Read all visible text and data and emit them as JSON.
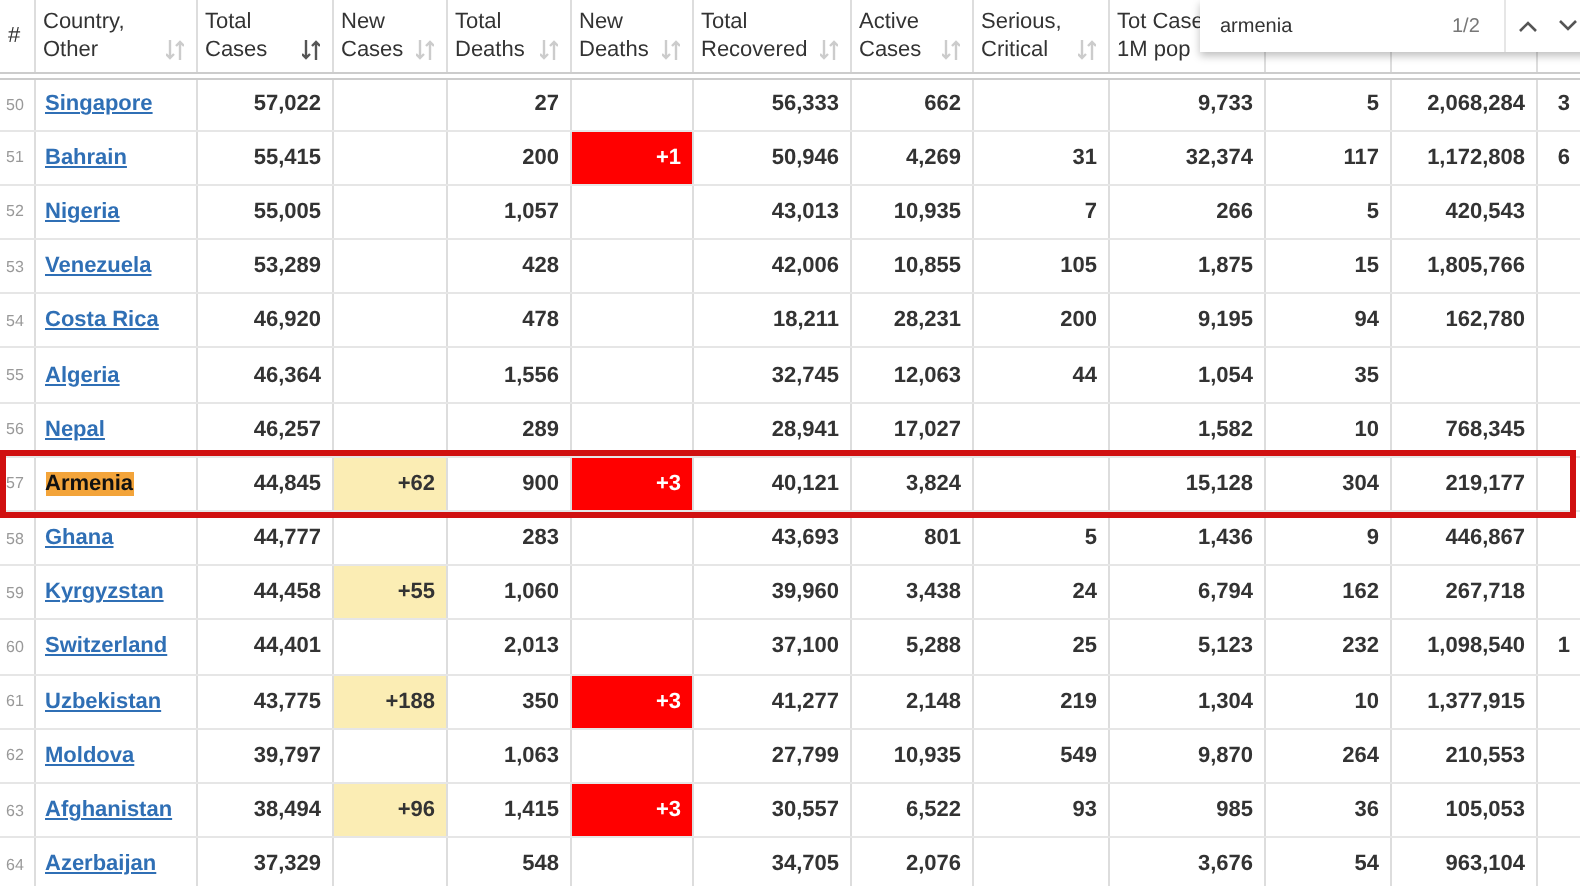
{
  "columns": [
    {
      "lines": [
        "#"
      ],
      "sortable": false
    },
    {
      "lines": [
        "Country,",
        "Other"
      ],
      "sortable": true,
      "sorted": false
    },
    {
      "lines": [
        "Total",
        "Cases"
      ],
      "sortable": true,
      "sorted": true
    },
    {
      "lines": [
        "New",
        "Cases"
      ],
      "sortable": true,
      "sorted": false
    },
    {
      "lines": [
        "Total",
        "Deaths"
      ],
      "sortable": true,
      "sorted": false
    },
    {
      "lines": [
        "New",
        "Deaths"
      ],
      "sortable": true,
      "sorted": false
    },
    {
      "lines": [
        "Total",
        "Recovered"
      ],
      "sortable": true,
      "sorted": false
    },
    {
      "lines": [
        "Active",
        "Cases"
      ],
      "sortable": true,
      "sorted": false
    },
    {
      "lines": [
        "Serious,",
        "Critical"
      ],
      "sortable": true,
      "sorted": false
    },
    {
      "lines": [
        "Tot Case",
        "1M pop"
      ],
      "sortable": false
    }
  ],
  "rows": [
    {
      "rank": "50",
      "country": "Singapore",
      "total_cases": "57,022",
      "total_deaths": "27",
      "total_recovered": "56,333",
      "active_cases": "662",
      "column_10": "9,733",
      "column_11": "5",
      "column_12": "2,068,284",
      "column_13": "3",
      "current_match": false
    },
    {
      "rank": "51",
      "country": "Bahrain",
      "total_cases": "55,415",
      "total_deaths": "200",
      "new_deaths": "+1",
      "total_recovered": "50,946",
      "active_cases": "4,269",
      "serious_critical": "31",
      "column_10": "32,374",
      "column_11": "117",
      "column_12": "1,172,808",
      "column_13": "6",
      "current_match": false
    },
    {
      "rank": "52",
      "country": "Nigeria",
      "total_cases": "55,005",
      "total_deaths": "1,057",
      "total_recovered": "43,013",
      "active_cases": "10,935",
      "serious_critical": "7",
      "column_10": "266",
      "column_11": "5",
      "column_12": "420,543",
      "current_match": false
    },
    {
      "rank": "53",
      "country": "Venezuela",
      "total_cases": "53,289",
      "total_deaths": "428",
      "total_recovered": "42,006",
      "active_cases": "10,855",
      "serious_critical": "105",
      "column_10": "1,875",
      "column_11": "15",
      "column_12": "1,805,766",
      "current_match": false
    },
    {
      "rank": "54",
      "country": "Costa Rica",
      "total_cases": "46,920",
      "total_deaths": "478",
      "total_recovered": "18,211",
      "active_cases": "28,231",
      "serious_critical": "200",
      "column_10": "9,195",
      "column_11": "94",
      "column_12": "162,780",
      "current_match": false
    },
    {
      "rank": "55",
      "country": "Algeria",
      "total_cases": "46,364",
      "total_deaths": "1,556",
      "total_recovered": "32,745",
      "active_cases": "12,063",
      "serious_critical": "44",
      "column_10": "1,054",
      "column_11": "35",
      "current_match": false
    },
    {
      "rank": "56",
      "country": "Nepal",
      "total_cases": "46,257",
      "total_deaths": "289",
      "total_recovered": "28,941",
      "active_cases": "17,027",
      "column_10": "1,582",
      "column_11": "10",
      "column_12": "768,345",
      "current_match": false
    },
    {
      "rank": "57",
      "country": "Armenia",
      "total_cases": "44,845",
      "new_cases": "+62",
      "total_deaths": "900",
      "new_deaths": "+3",
      "total_recovered": "40,121",
      "active_cases": "3,824",
      "column_10": "15,128",
      "column_11": "304",
      "column_12": "219,177",
      "current_match": true
    },
    {
      "rank": "58",
      "country": "Ghana",
      "total_cases": "44,777",
      "total_deaths": "283",
      "total_recovered": "43,693",
      "active_cases": "801",
      "serious_critical": "5",
      "column_10": "1,436",
      "column_11": "9",
      "column_12": "446,867",
      "current_match": false
    },
    {
      "rank": "59",
      "country": "Kyrgyzstan",
      "total_cases": "44,458",
      "new_cases": "+55",
      "total_deaths": "1,060",
      "total_recovered": "39,960",
      "active_cases": "3,438",
      "serious_critical": "24",
      "column_10": "6,794",
      "column_11": "162",
      "column_12": "267,718",
      "current_match": false
    },
    {
      "rank": "60",
      "country": "Switzerland",
      "total_cases": "44,401",
      "total_deaths": "2,013",
      "total_recovered": "37,100",
      "active_cases": "5,288",
      "serious_critical": "25",
      "column_10": "5,123",
      "column_11": "232",
      "column_12": "1,098,540",
      "column_13": "1",
      "current_match": false
    },
    {
      "rank": "61",
      "country": "Uzbekistan",
      "total_cases": "43,775",
      "new_cases": "+188",
      "total_deaths": "350",
      "new_deaths": "+3",
      "total_recovered": "41,277",
      "active_cases": "2,148",
      "serious_critical": "219",
      "column_10": "1,304",
      "column_11": "10",
      "column_12": "1,377,915",
      "current_match": false
    },
    {
      "rank": "62",
      "country": "Moldova",
      "total_cases": "39,797",
      "total_deaths": "1,063",
      "total_recovered": "27,799",
      "active_cases": "10,935",
      "serious_critical": "549",
      "column_10": "9,870",
      "column_11": "264",
      "column_12": "210,553",
      "current_match": false
    },
    {
      "rank": "63",
      "country": "Afghanistan",
      "total_cases": "38,494",
      "new_cases": "+96",
      "total_deaths": "1,415",
      "new_deaths": "+3",
      "total_recovered": "30,557",
      "active_cases": "6,522",
      "serious_critical": "93",
      "column_10": "985",
      "column_11": "36",
      "column_12": "105,053",
      "current_match": false
    },
    {
      "rank": "64",
      "country": "Azerbaijan",
      "total_cases": "37,329",
      "total_deaths": "548",
      "total_recovered": "34,705",
      "active_cases": "2,076",
      "column_10": "3,676",
      "column_11": "54",
      "column_12": "963,104",
      "current_match": false
    }
  ],
  "find_bar": {
    "query": "armenia",
    "count": "1/2"
  }
}
